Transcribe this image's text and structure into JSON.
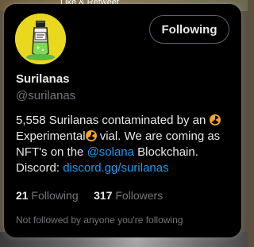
{
  "background": {
    "top_text": "Like & Retweet"
  },
  "card": {
    "follow_button_label": "Following",
    "display_name": "Surilanas",
    "handle": "@surilanas",
    "bio": {
      "part1": "5,558 Surilanas contaminated by an ",
      "part2": " Experimental",
      "part3": " vial. We are coming as NFT's on the ",
      "mention": "@solana",
      "part4": " Blockchain. Discord: ",
      "link": "discord.gg/surilanas"
    },
    "following_count": "21",
    "following_label": "Following",
    "followers_count": "317",
    "followers_label": "Followers",
    "relationship_note": "Not followed by anyone you're following"
  },
  "colors": {
    "card_bg": "#000000",
    "text_primary": "#e7e9ea",
    "text_secondary": "#71767b",
    "link": "#1d9bf0",
    "avatar_bg": "#e9d81e"
  },
  "icons": [
    "radioactive-emoji-icon",
    "avatar-vial-image"
  ]
}
